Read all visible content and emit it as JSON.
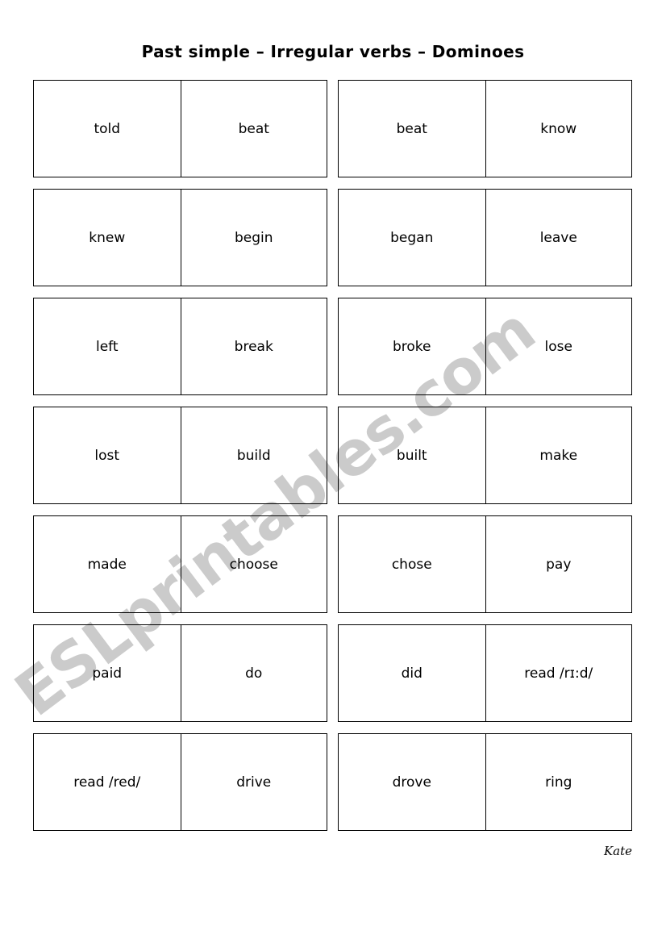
{
  "page": {
    "title": "Past simple – Irregular verbs – Dominoes",
    "signature": "Kate",
    "watermark": "ESLprintables.com",
    "colors": {
      "ink": "#000000",
      "paper": "#ffffff",
      "watermark": "#c9c9c9"
    }
  },
  "dominoes": {
    "rows": [
      {
        "left": {
          "a": "told",
          "b": "beat"
        },
        "right": {
          "a": "beat",
          "b": "know"
        }
      },
      {
        "left": {
          "a": "knew",
          "b": "begin"
        },
        "right": {
          "a": "began",
          "b": "leave"
        }
      },
      {
        "left": {
          "a": "left",
          "b": "break"
        },
        "right": {
          "a": "broke",
          "b": "lose"
        }
      },
      {
        "left": {
          "a": "lost",
          "b": "build"
        },
        "right": {
          "a": "built",
          "b": "make"
        }
      },
      {
        "left": {
          "a": "made",
          "b": "choose"
        },
        "right": {
          "a": "chose",
          "b": "pay"
        }
      },
      {
        "left": {
          "a": "paid",
          "b": "do"
        },
        "right": {
          "a": "did",
          "b": "read /rɪ:d/"
        }
      },
      {
        "left": {
          "a": "read /red/",
          "b": "drive"
        },
        "right": {
          "a": "drove",
          "b": "ring"
        }
      }
    ]
  }
}
